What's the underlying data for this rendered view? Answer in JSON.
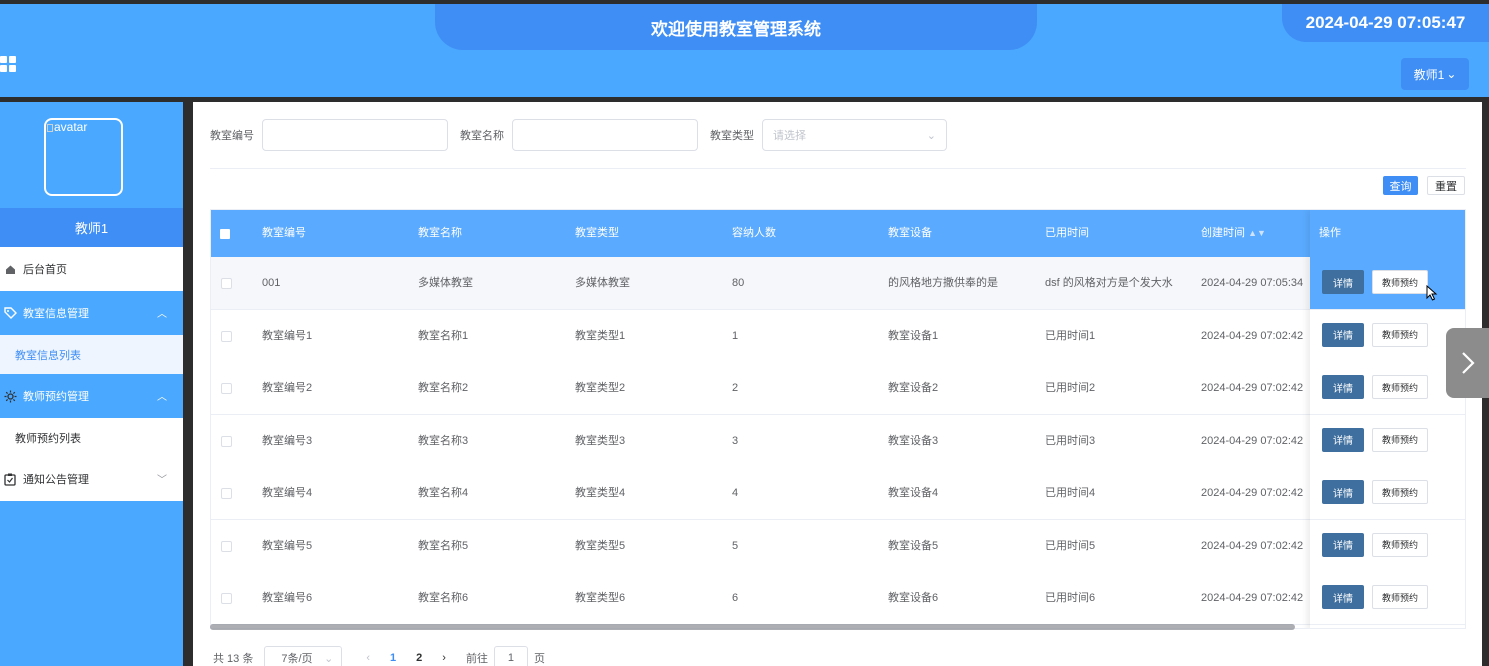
{
  "header": {
    "title": "欢迎使用教室管理系统",
    "datetime": "2024-04-29 07:05:47",
    "user_button": "教师1"
  },
  "sidebar": {
    "avatar_alt": "avatar",
    "username": "教师1",
    "menu": [
      {
        "label": "后台首页",
        "icon": "home-icon"
      },
      {
        "label": "教室信息管理",
        "icon": "tag-icon",
        "expanded": true,
        "children": [
          "教室信息列表"
        ]
      },
      {
        "label": "教师预约管理",
        "icon": "sun-icon",
        "expanded": true,
        "children": [
          "教师预约列表"
        ]
      },
      {
        "label": "通知公告管理",
        "icon": "clipboard-icon",
        "expanded": false
      }
    ]
  },
  "search": {
    "fields": [
      {
        "label": "教室编号",
        "value": ""
      },
      {
        "label": "教室名称",
        "value": ""
      },
      {
        "label": "教室类型",
        "placeholder": "请选择"
      }
    ],
    "query_label": "查询",
    "reset_label": "重置"
  },
  "table": {
    "columns": [
      "教室编号",
      "教室名称",
      "教室类型",
      "容纳人数",
      "教室设备",
      "已用时间",
      "创建时间",
      "操作"
    ],
    "rows": [
      [
        "001",
        "多媒体教室",
        "多媒体教室",
        "80",
        "的风格地方撒供奉的是",
        "dsf 的风格对方是个发大水",
        "2024-04-29 07:05:34"
      ],
      [
        "教室编号1",
        "教室名称1",
        "教室类型1",
        "1",
        "教室设备1",
        "已用时间1",
        "2024-04-29 07:02:42"
      ],
      [
        "教室编号2",
        "教室名称2",
        "教室类型2",
        "2",
        "教室设备2",
        "已用时间2",
        "2024-04-29 07:02:42"
      ],
      [
        "教室编号3",
        "教室名称3",
        "教室类型3",
        "3",
        "教室设备3",
        "已用时间3",
        "2024-04-29 07:02:42"
      ],
      [
        "教室编号4",
        "教室名称4",
        "教室类型4",
        "4",
        "教室设备4",
        "已用时间4",
        "2024-04-29 07:02:42"
      ],
      [
        "教室编号5",
        "教室名称5",
        "教室类型5",
        "5",
        "教室设备5",
        "已用时间5",
        "2024-04-29 07:02:42"
      ],
      [
        "教室编号6",
        "教室名称6",
        "教室类型6",
        "6",
        "教室设备6",
        "已用时间6",
        "2024-04-29 07:02:42"
      ]
    ],
    "detail_label": "详情",
    "book_label": "教师预约"
  },
  "pagination": {
    "total": "共 13 条",
    "page_size": "7条/页",
    "pages": [
      "1",
      "2"
    ],
    "current_page": "1",
    "goto_prefix": "前往",
    "goto_value": "1",
    "goto_suffix": "页"
  },
  "colors": {
    "primary": "#4aa8ff",
    "accent": "#3f8ef5",
    "detail_button": "#3e6f9e"
  }
}
